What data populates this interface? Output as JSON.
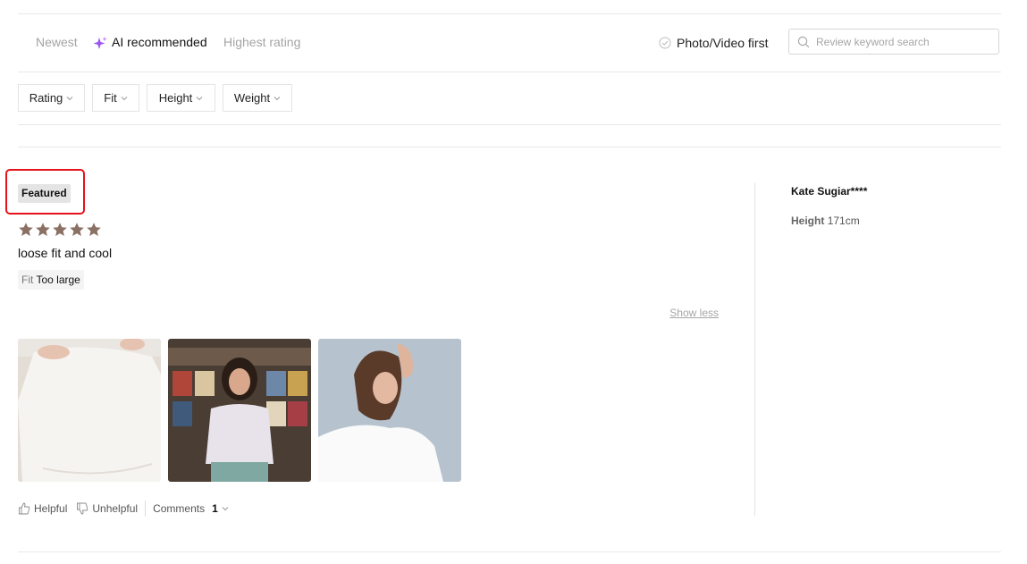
{
  "sort_tabs": [
    {
      "label": "Newest",
      "active": false
    },
    {
      "label": "AI recommended",
      "active": true
    },
    {
      "label": "Highest rating",
      "active": false
    }
  ],
  "photo_first_label": "Photo/Video first",
  "search": {
    "placeholder": "Review keyword search",
    "value": ""
  },
  "filters": [
    "Rating",
    "Fit",
    "Height",
    "Weight"
  ],
  "review": {
    "featured_label": "Featured",
    "rating": 5,
    "text": "loose fit and cool",
    "fit_key": "Fit",
    "fit_value": "Too large",
    "show_less": "Show less",
    "photos": [
      "white-tshirt-closeup-photo",
      "woman-white-tshirt-record-store-photo",
      "woman-white-tshirt-profile-photo"
    ],
    "helpful_label": "Helpful",
    "unhelpful_label": "Unhelpful",
    "comments_label": "Comments",
    "comments_count": "1"
  },
  "reviewer": {
    "name": "Kate Sugiar****",
    "height_key": "Height",
    "height_value": "171cm"
  },
  "colors": {
    "star": "#8b7064",
    "highlight_border": "#e5121b",
    "ai_icon": "#9a54f0"
  }
}
